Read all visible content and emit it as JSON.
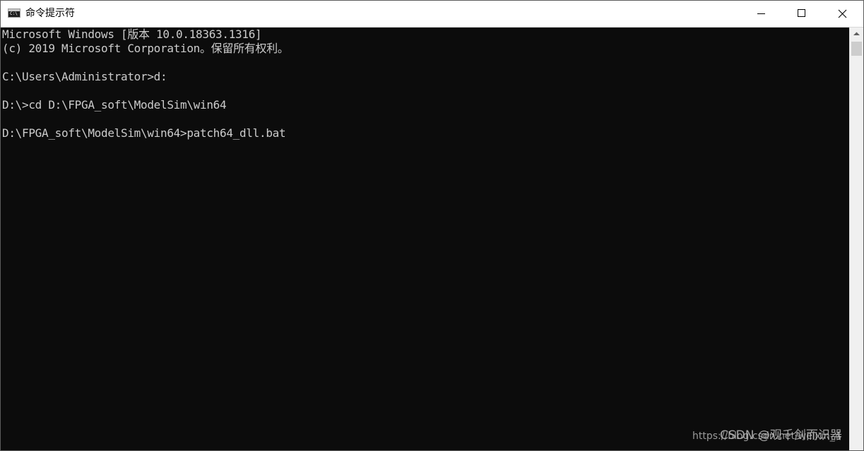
{
  "window": {
    "title": "命令提示符",
    "icon": "cmd-app-icon",
    "icon_glyph": "C:\\"
  },
  "caption_buttons": {
    "minimize": "minimize-icon",
    "maximize": "maximize-icon",
    "close": "close-icon"
  },
  "console": {
    "lines": [
      "Microsoft Windows [版本 10.0.18363.1316]",
      "(c) 2019 Microsoft Corporation。保留所有权利。",
      "",
      "C:\\Users\\Administrator>d:",
      "",
      "D:\\>cd D:\\FPGA_soft\\ModelSim\\win64",
      "",
      "D:\\FPGA_soft\\ModelSim\\win64>patch64_dll.bat"
    ]
  },
  "watermark": {
    "url_text": "https://blog.csdn.net/weixin_4",
    "csdn_text": "CSDN @观千剑而识器"
  },
  "colors": {
    "console_bg": "#0c0c0c",
    "console_fg": "#cccccc",
    "titlebar_bg": "#ffffff"
  }
}
